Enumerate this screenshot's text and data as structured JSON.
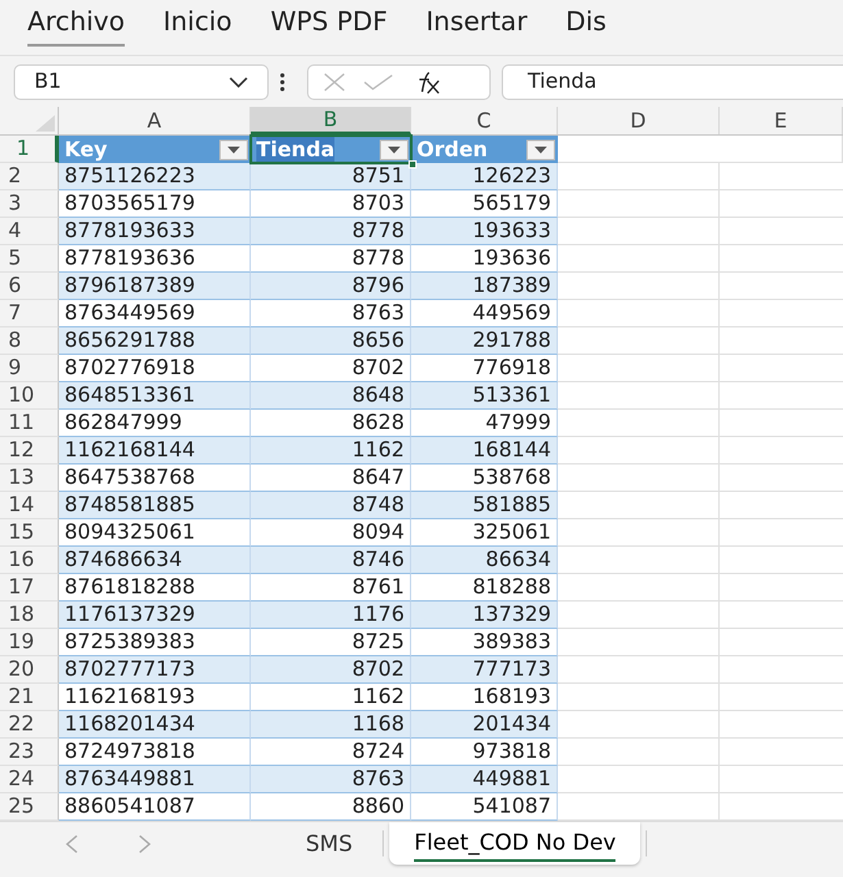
{
  "menu": [
    {
      "label": "Archivo",
      "selected": true
    },
    {
      "label": "Inicio",
      "selected": false
    },
    {
      "label": "WPS PDF",
      "selected": false
    },
    {
      "label": "Insertar",
      "selected": false
    },
    {
      "label": "Dis",
      "selected": false
    }
  ],
  "name_box": {
    "value": "B1"
  },
  "formula_bar": {
    "value": "Tienda"
  },
  "columns": [
    {
      "label": "A",
      "selected": false
    },
    {
      "label": "B",
      "selected": true
    },
    {
      "label": "C",
      "selected": false
    },
    {
      "label": "D",
      "selected": false
    },
    {
      "label": "E",
      "selected": false
    }
  ],
  "header_row": {
    "number": "1",
    "cells": [
      {
        "text": "Key",
        "selected": false
      },
      {
        "text": "Tienda",
        "selected": true
      },
      {
        "text": "Orden",
        "selected": false
      }
    ]
  },
  "rows": [
    {
      "number": "2",
      "cells": [
        "8751126223",
        "8751",
        "126223"
      ]
    },
    {
      "number": "3",
      "cells": [
        "8703565179",
        "8703",
        "565179"
      ]
    },
    {
      "number": "4",
      "cells": [
        "8778193633",
        "8778",
        "193633"
      ]
    },
    {
      "number": "5",
      "cells": [
        "8778193636",
        "8778",
        "193636"
      ]
    },
    {
      "number": "6",
      "cells": [
        "8796187389",
        "8796",
        "187389"
      ]
    },
    {
      "number": "7",
      "cells": [
        "8763449569",
        "8763",
        "449569"
      ]
    },
    {
      "number": "8",
      "cells": [
        "8656291788",
        "8656",
        "291788"
      ]
    },
    {
      "number": "9",
      "cells": [
        "8702776918",
        "8702",
        "776918"
      ]
    },
    {
      "number": "10",
      "cells": [
        "8648513361",
        "8648",
        "513361"
      ]
    },
    {
      "number": "11",
      "cells": [
        "862847999",
        "8628",
        "47999"
      ]
    },
    {
      "number": "12",
      "cells": [
        "1162168144",
        "1162",
        "168144"
      ]
    },
    {
      "number": "13",
      "cells": [
        "8647538768",
        "8647",
        "538768"
      ]
    },
    {
      "number": "14",
      "cells": [
        "8748581885",
        "8748",
        "581885"
      ]
    },
    {
      "number": "15",
      "cells": [
        "8094325061",
        "8094",
        "325061"
      ]
    },
    {
      "number": "16",
      "cells": [
        "874686634",
        "8746",
        "86634"
      ]
    },
    {
      "number": "17",
      "cells": [
        "8761818288",
        "8761",
        "818288"
      ]
    },
    {
      "number": "18",
      "cells": [
        "1176137329",
        "1176",
        "137329"
      ]
    },
    {
      "number": "19",
      "cells": [
        "8725389383",
        "8725",
        "389383"
      ]
    },
    {
      "number": "20",
      "cells": [
        "8702777173",
        "8702",
        "777173"
      ]
    },
    {
      "number": "21",
      "cells": [
        "1162168193",
        "1162",
        "168193"
      ]
    },
    {
      "number": "22",
      "cells": [
        "1168201434",
        "1168",
        "201434"
      ]
    },
    {
      "number": "23",
      "cells": [
        "8724973818",
        "8724",
        "973818"
      ]
    },
    {
      "number": "24",
      "cells": [
        "8763449881",
        "8763",
        "449881"
      ]
    },
    {
      "number": "25",
      "cells": [
        "8860541087",
        "8860",
        "541087"
      ]
    }
  ],
  "sheet_tabs": [
    {
      "label": "SMS",
      "selected": false
    },
    {
      "label": "Fleet_COD No Dev",
      "selected": true
    }
  ]
}
